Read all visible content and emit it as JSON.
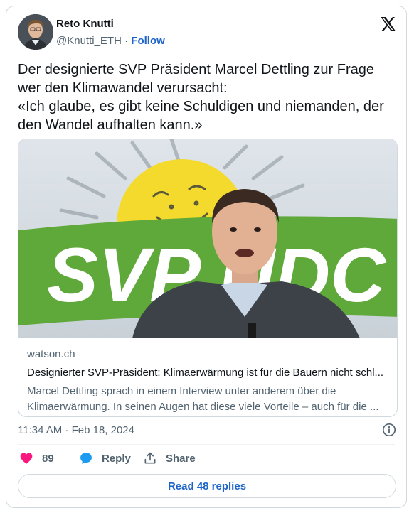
{
  "author": {
    "name": "Reto Knutti",
    "handle": "@Knutti_ETH",
    "separator": "·",
    "follow_label": "Follow"
  },
  "platform_icon": "x-logo-icon",
  "tweet": {
    "lines": [
      "Der designierte SVP Präsident Marcel Dettling zur Frage",
      "wer den Klimawandel verursacht:",
      "«Ich glaube, es gibt keine Schuldigen und niemanden, der",
      "den Wandel aufhalten kann.»"
    ]
  },
  "link_card": {
    "image_text": "SVP UDC",
    "domain": "watson.ch",
    "title": "Designierter SVP-Präsident: Klimaerwärmung ist für die Bauern nicht schl...",
    "description_lines": [
      "Marcel Dettling sprach in einem Interview unter anderem über die",
      "Klimaerwärmung. In seinen Augen hat diese viele Vorteile – auch für die ..."
    ]
  },
  "timestamp": "11:34 AM · Feb 18, 2024",
  "actions": {
    "like_count": "89",
    "reply_label": "Reply",
    "share_label": "Share"
  },
  "read_replies_label": "Read 48 replies",
  "colors": {
    "accent": "#1d64c8",
    "heart": "#f91880",
    "reply": "#1d9bf0",
    "muted": "#536471",
    "svp_green": "#5fa83a",
    "svp_sun": "#f3da2c"
  }
}
